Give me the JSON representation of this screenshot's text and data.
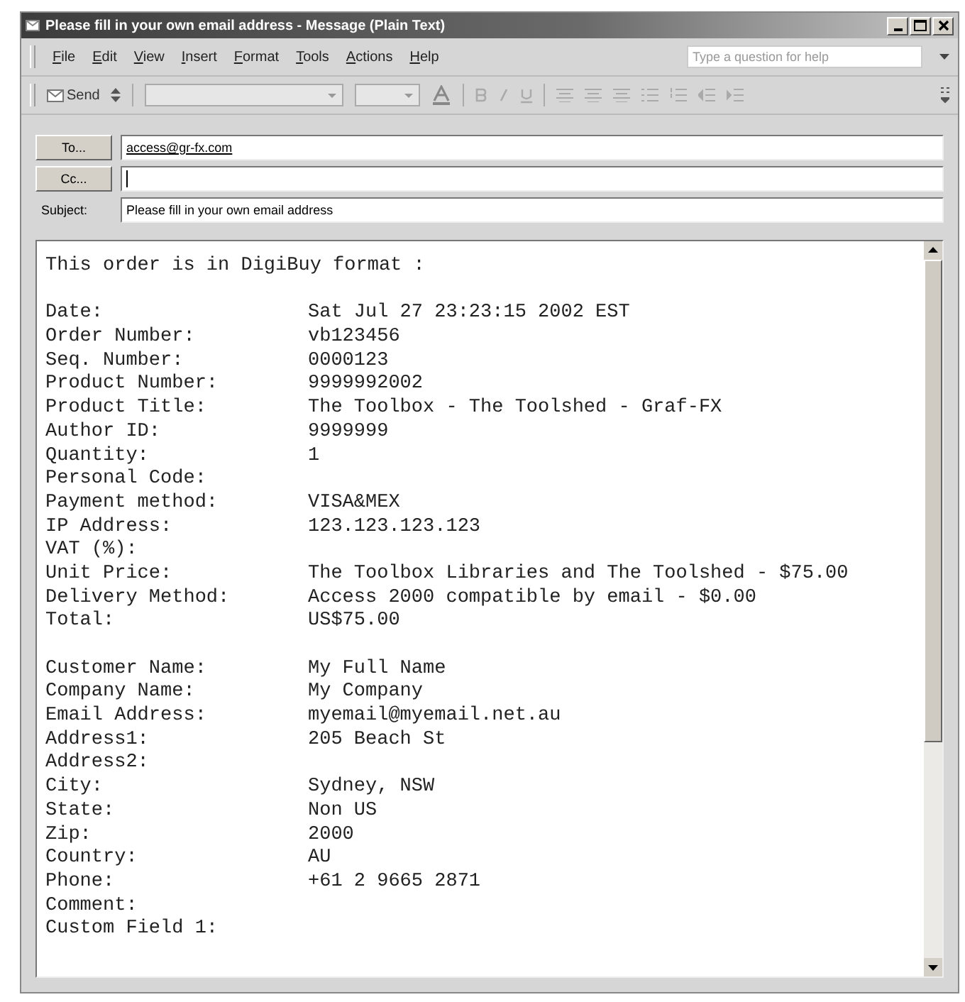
{
  "window": {
    "title": "Please fill in your own email address - Message (Plain Text)"
  },
  "menu": [
    {
      "label": "File"
    },
    {
      "label": "Edit"
    },
    {
      "label": "View"
    },
    {
      "label": "Insert"
    },
    {
      "label": "Format"
    },
    {
      "label": "Tools"
    },
    {
      "label": "Actions"
    },
    {
      "label": "Help"
    }
  ],
  "help_search": {
    "placeholder": "Type a question for help"
  },
  "toolbar": {
    "send": "Send"
  },
  "header": {
    "to_button": "To...",
    "to": "access@gr-fx.com",
    "cc_button": "Cc...",
    "subject_label": "Subject:",
    "subject": "Please fill in your own email address"
  },
  "body": {
    "intro": "This order is in DigiBuy format :",
    "sections": [
      [
        {
          "label": "Date:",
          "value": "Sat Jul 27 23:23:15 2002 EST"
        },
        {
          "label": "Order Number:",
          "value": "vb123456"
        },
        {
          "label": "Seq. Number:",
          "value": "0000123"
        },
        {
          "label": "Product Number:",
          "value": "9999992002"
        },
        {
          "label": "Product Title:",
          "value": "The Toolbox - The Toolshed - Graf-FX"
        },
        {
          "label": "Author ID:",
          "value": "9999999"
        },
        {
          "label": "Quantity:",
          "value": "1"
        },
        {
          "label": "Personal Code:"
        },
        {
          "label": "Payment method:",
          "value": "VISA&MEX"
        },
        {
          "label": "IP Address:",
          "value": "123.123.123.123"
        },
        {
          "label": "VAT (%):"
        },
        {
          "label": "Unit Price:",
          "value": "The Toolbox Libraries and The Toolshed - $75.00"
        },
        {
          "label": "Delivery Method:",
          "value": "Access 2000 compatible by email - $0.00"
        },
        {
          "label": "Total:",
          "value": "US$75.00"
        }
      ],
      [
        {
          "label": "Customer Name:",
          "value": "My Full Name"
        },
        {
          "label": "Company Name:",
          "value": "My Company"
        },
        {
          "label": "Email Address:",
          "value": "myemail@myemail.net.au"
        },
        {
          "label": "Address1:",
          "value": "205 Beach St"
        },
        {
          "label": "Address2:"
        },
        {
          "label": "City:",
          "value": "Sydney, NSW"
        },
        {
          "label": "State:",
          "value": "Non US"
        },
        {
          "label": "Zip:",
          "value": "2000"
        },
        {
          "label": "Country:",
          "value": "AU"
        },
        {
          "label": "Phone:",
          "value": "+61 2 9665 2871"
        },
        {
          "label": "Comment:"
        },
        {
          "label": "Custom Field 1:"
        }
      ]
    ]
  }
}
